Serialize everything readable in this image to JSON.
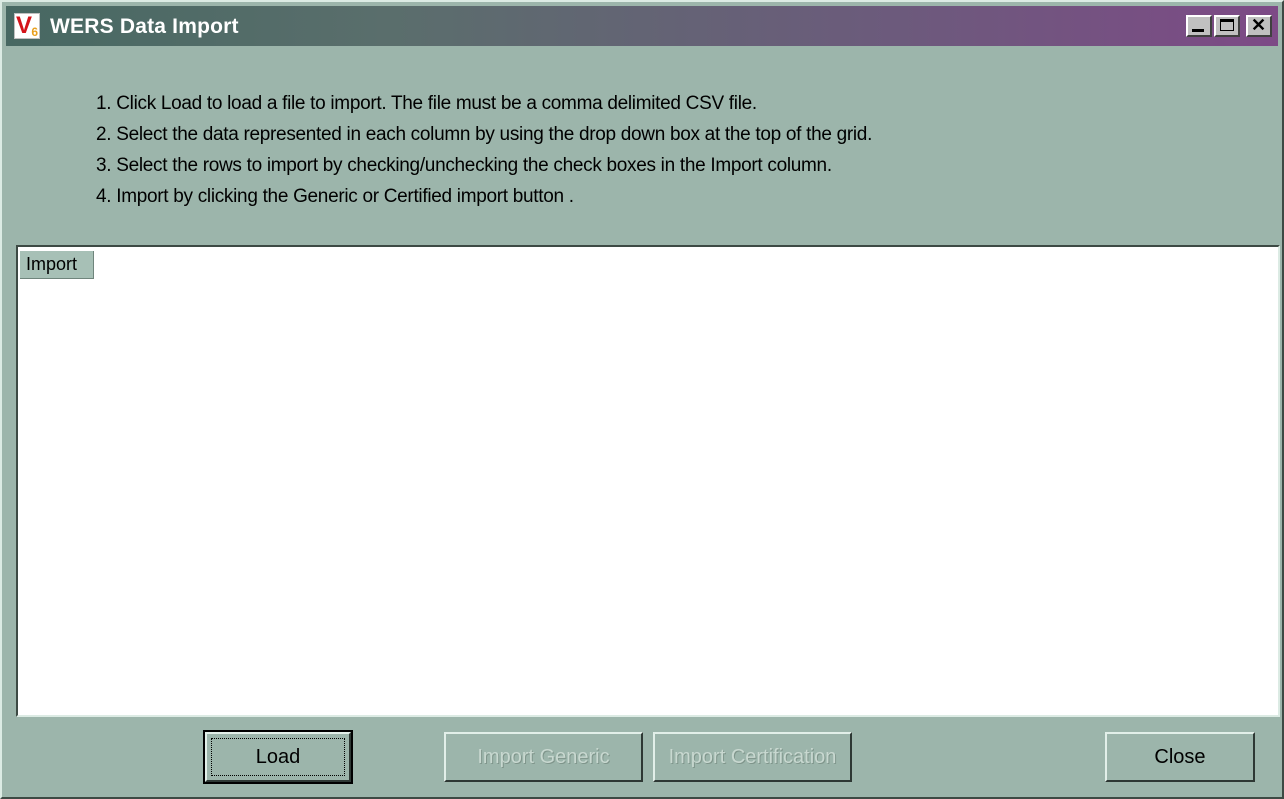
{
  "window": {
    "title": "WERS Data Import",
    "app_icon": "V6-app-icon",
    "controls": [
      "minimize-icon",
      "maximize-icon",
      "close-icon"
    ]
  },
  "instructions": [
    "1. Click Load to load a file to import. The file must be a comma delimited CSV file.",
    "2. Select the data represented in each column by using the drop down box at the top of the grid.",
    "3. Select the rows to import by checking/unchecking the check boxes in the Import column.",
    "4. Import by clicking the Generic or Certified import button ."
  ],
  "grid": {
    "columns": [
      "Import"
    ],
    "rows": []
  },
  "buttons": {
    "load": "Load",
    "import_generic": "Import Generic",
    "import_certification": "Import Certification",
    "close": "Close"
  },
  "colors": {
    "window_background": "#9cb5ab",
    "title_gradient_start": "#476862",
    "title_gradient_end": "#7d4a86"
  }
}
